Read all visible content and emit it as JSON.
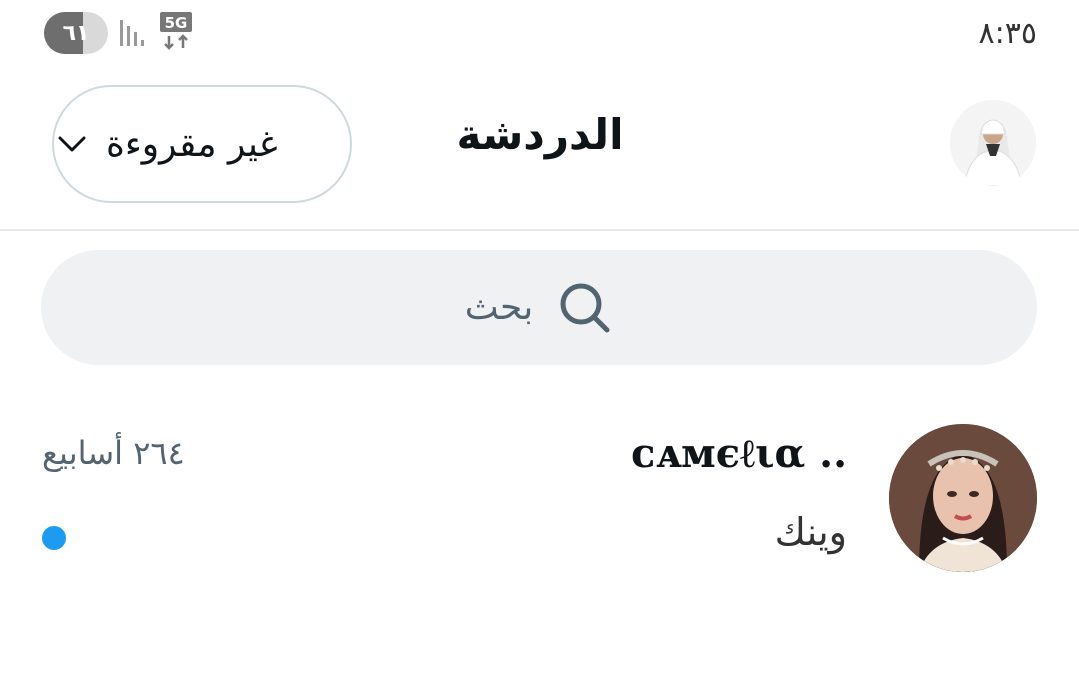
{
  "status_bar": {
    "battery": "٦١",
    "battery_level": 0.61,
    "network": "5G",
    "time": "٨:٣٥",
    "signal_icon": "signal-bars-icon",
    "network_icon": "5g-data-icon"
  },
  "header": {
    "filter_label": "غير مقروءة",
    "filter_icon": "chevron-down-icon",
    "title": "الدردشة",
    "profile_avatar_icon": "profile-avatar"
  },
  "search": {
    "placeholder": "بحث",
    "icon": "search-icon"
  },
  "conversations": [
    {
      "name": "ᴄᴀᴍєℓια ..",
      "preview": "وينك",
      "time": "٢٦٤ أسابيع",
      "unread": true
    }
  ],
  "colors": {
    "accent": "#1d9bf0",
    "divider": "#e6e9eb",
    "search_bg": "#eff1f3",
    "secondary_text": "#536471"
  }
}
